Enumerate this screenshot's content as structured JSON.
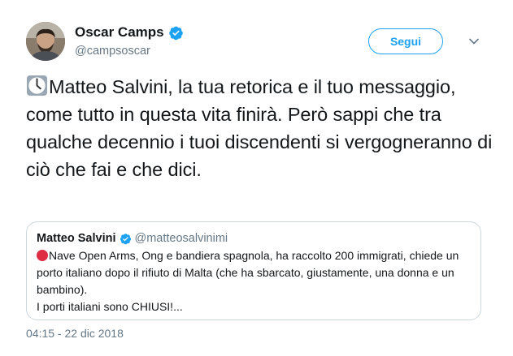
{
  "author": {
    "display_name": "Oscar Camps",
    "handle": "@campsoscar",
    "verified": true
  },
  "follow_button": {
    "label": "Segui"
  },
  "tweet": {
    "icon": "clock-icon",
    "text": "Matteo Salvini, la tua retorica e il tuo messaggio, come tutto in questa vita finirà. Però sappi che tra qualche decennio i tuoi discendenti si vergogneranno di ciò che fai e che dici.",
    "timestamp": "04:15 - 22 dic 2018"
  },
  "quoted_tweet": {
    "display_name": "Matteo Salvini",
    "handle": "@matteosalvinimi",
    "verified": true,
    "icon": "red-circle-icon",
    "text_line1": "Nave Open Arms, Ong e bandiera spagnola, ha raccolto 200 immigrati, chiede un porto italiano dopo il rifiuto di Malta (che ha sbarcato, giustamente, una donna e un bambino).",
    "text_line2": "I porti italiani sono CHIUSI!..."
  },
  "colors": {
    "accent": "#1da1f2",
    "secondary_text": "#657786",
    "border": "#ccd6dd",
    "red_dot": "#dd2e44"
  }
}
